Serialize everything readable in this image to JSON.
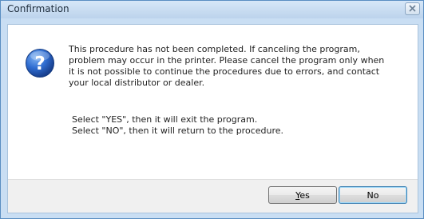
{
  "window": {
    "title": "Confirmation"
  },
  "message": {
    "lines": [
      "This procedure has not been completed. If canceling the program,",
      "problem may occur in the printer. Please cancel the program only when",
      "it is not possible to continue the procedures due to errors, and contact",
      "your local distributor or dealer."
    ],
    "instructions": [
      "Select \"YES\", then it will exit the program.",
      "Select \"NO\", then it will return to the procedure."
    ]
  },
  "buttons": {
    "yes_mnemonic": "Y",
    "yes_rest": "es",
    "no_label": "No"
  },
  "colors": {
    "title_bar": "#c9def3",
    "icon_blue": "#1f57b6"
  },
  "icons": {
    "message_icon": "question-icon",
    "close_icon": "close-icon"
  }
}
